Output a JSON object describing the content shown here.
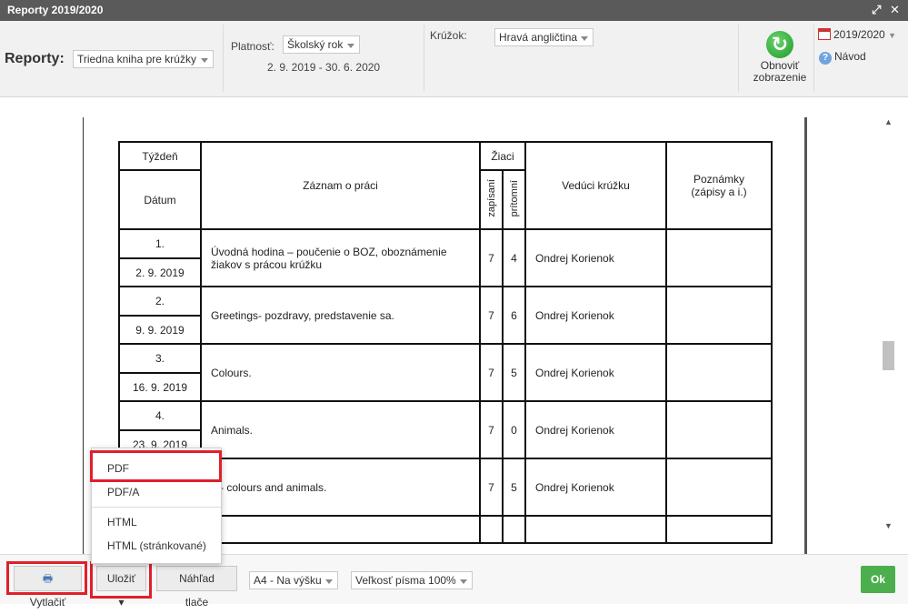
{
  "window": {
    "title": "Reporty 2019/2020"
  },
  "toolbar": {
    "reports_label": "Reporty:",
    "report_select": "Triedna kniha pre krúžky",
    "validity_label": "Platnosť:",
    "validity_select": "Školský rok",
    "date_range": "2. 9. 2019 - 30. 6. 2020",
    "circle_label": "Krúžok:",
    "circle_select": "Hravá angličtina",
    "refresh_line1": "Obnoviť",
    "refresh_line2": "zobrazenie",
    "year_label": "2019/2020",
    "help_label": "Návod"
  },
  "table": {
    "headers": {
      "week": "Týždeň",
      "date": "Dátum",
      "record": "Záznam o práci",
      "students": "Žiaci",
      "enrolled": "zapísaní",
      "present": "prítomní",
      "leader": "Vedúci krúžku",
      "notes": "Poznámky (zápisy a i.)"
    },
    "rows": [
      {
        "week": "1.",
        "date": "2. 9. 2019",
        "record": "Úvodná hodina – poučenie o BOZ, oboznámenie žiakov s prácou krúžku",
        "enrolled": "7",
        "present": "4",
        "leader": "Ondrej Korienok",
        "notes": ""
      },
      {
        "week": "2.",
        "date": "9. 9. 2019",
        "record": "Greetings- pozdravy, predstavenie sa.",
        "enrolled": "7",
        "present": "6",
        "leader": "Ondrej Korienok",
        "notes": ""
      },
      {
        "week": "3.",
        "date": "16. 9. 2019",
        "record": "Colours.",
        "enrolled": "7",
        "present": "5",
        "leader": "Ondrej Korienok",
        "notes": ""
      },
      {
        "week": "4.",
        "date": "23. 9. 2019",
        "record": "Animals.",
        "enrolled": "7",
        "present": "0",
        "leader": "Ondrej Korienok",
        "notes": ""
      },
      {
        "week": "",
        "date": "",
        "record": "a - colours and animals.",
        "enrolled": "7",
        "present": "5",
        "leader": "Ondrej Korienok",
        "notes": ""
      }
    ]
  },
  "dropdown": {
    "items": [
      "PDF",
      "PDF/A",
      "HTML",
      "HTML (stránkované)"
    ]
  },
  "bottom": {
    "print_label": "Vytlačiť",
    "save_label": "Uložiť ▾",
    "preview_label": "Náhľad tlače",
    "page_format": "A4 - Na výšku",
    "font_size": "Veľkosť písma 100%",
    "ok_label": "Ok"
  },
  "colors": {
    "highlight": "#e0202a",
    "ok": "#4cae4c",
    "titlebar": "#5a5a5a"
  }
}
